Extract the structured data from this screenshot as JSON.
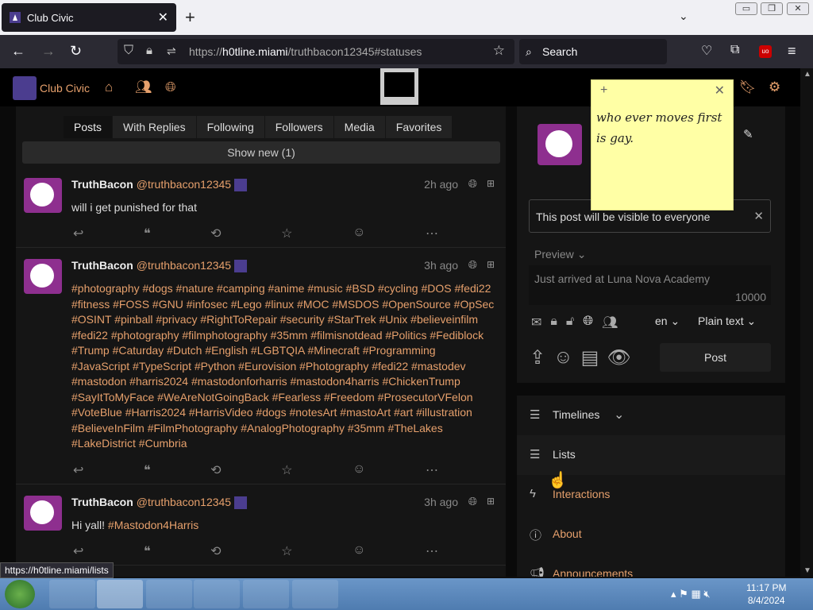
{
  "browser": {
    "tab_title": "Club Civic",
    "url_prefix": "https://",
    "url_host": "h0tline.miami",
    "url_path": "/truthbacon12345#statuses",
    "search_placeholder": "Search"
  },
  "app": {
    "brand": "Club Civic",
    "profile_tabs": [
      "Posts",
      "With Replies",
      "Following",
      "Followers",
      "Media",
      "Favorites"
    ],
    "show_new": "Show new (1)"
  },
  "statuses": [
    {
      "name": "TruthBacon",
      "handle": "@truthbacon12345",
      "time": "2h ago",
      "text": "will i get punished for that"
    },
    {
      "name": "TruthBacon",
      "handle": "@truthbacon12345",
      "time": "3h ago",
      "text": "#photography #dogs #nature #camping #anime #music #BSD #cycling #DOS #fedi22 #fitness #FOSS #GNU #infosec #Lego #linux #MOC #MSDOS #OpenSource #OpSec #OSINT #pinball #privacy #RightToRepair #security #StarTrek #Unix #believeinfilm #fedi22 #photography #filmphotography #35mm #filmisnotdead #Politics #Fediblock #Trump #Caturday #Dutch #English #LGBTQIA #Minecraft #Programming #JavaScript #TypeScript #Python #Eurovision #Photography #fedi22 #mastodev #mastodon #harris2024 #mastodonforharris #mastodon4harris #ChickenTrump #SayItToMyFace #WeAreNotGoingBack #Fearless #Freedom #ProsecutorVFelon #VoteBlue #Harris2024 #HarrisVideo #dogs #notesArt #mastoArt #art #illustration #BelieveInFilm #FilmPhotography #AnalogPhotography #35mm #TheLakes #LakeDistrict #Cumbria"
    },
    {
      "name": "TruthBacon",
      "handle": "@truthbacon12345",
      "time": "3h ago",
      "text_plain": "Hi yall! ",
      "text_tag": "#Mastodon4Harris"
    }
  ],
  "composer": {
    "visibility_notice": "This post will be visible to everyone",
    "preview_label": "Preview",
    "placeholder": "Just arrived at Luna Nova Academy",
    "char_count": "10000",
    "language": "en",
    "format": "Plain text",
    "post_label": "Post"
  },
  "sidebar_nav": [
    {
      "label": "Timelines",
      "icon": "list-icon"
    },
    {
      "label": "Lists",
      "icon": "list-icon"
    },
    {
      "label": "Interactions",
      "icon": "bolt-icon"
    },
    {
      "label": "About",
      "icon": "info-icon"
    },
    {
      "label": "Announcements",
      "icon": "bullhorn-icon"
    }
  ],
  "sticky_note": {
    "text": "who ever moves first is gay."
  },
  "status_link": "https://h0tline.miami/lists",
  "taskbar": {
    "time": "11:17 PM",
    "date": "8/4/2024"
  },
  "colors": {
    "accent": "#e6a06c",
    "panel": "#151515",
    "sticky": "#ffffa5"
  }
}
